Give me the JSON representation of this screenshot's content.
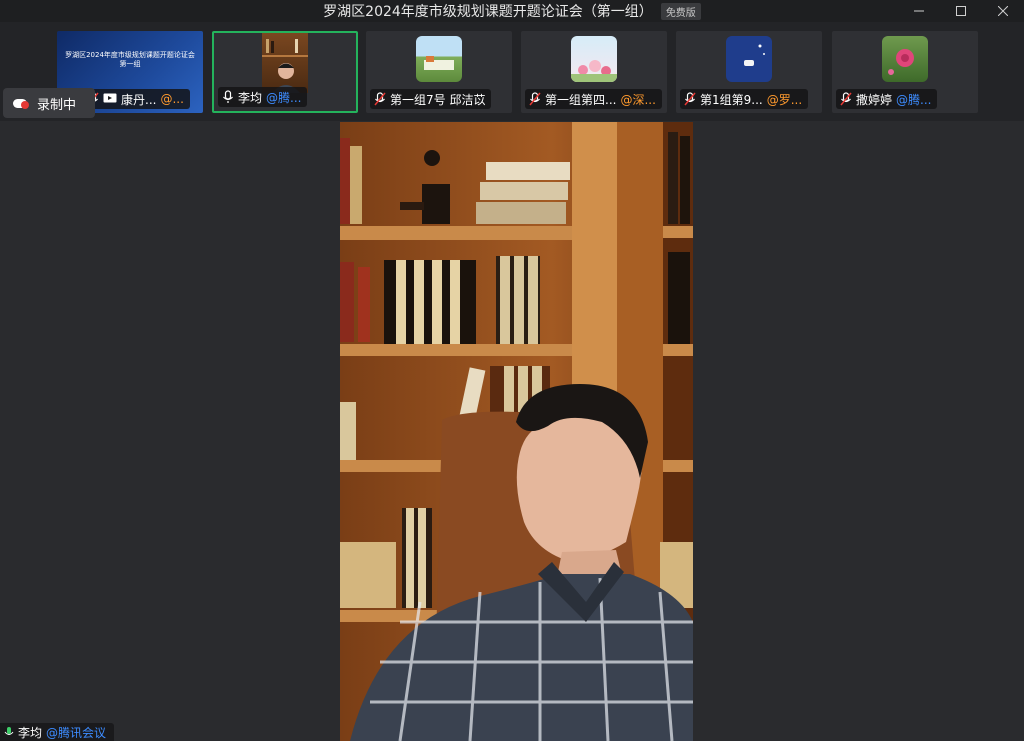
{
  "window": {
    "title": "罗湖区2024年度市级规划课题开题论证会（第一组）",
    "badge": "免费版"
  },
  "recording": {
    "label": "录制中"
  },
  "slide": {
    "text": "罗湖区2024年度市级规划课题开题论证会第一组"
  },
  "participants": [
    {
      "name": "康丹...",
      "source": "@...",
      "source_color": "orange",
      "muted": true,
      "sharing": true
    },
    {
      "name": "李均",
      "source": "@腾...",
      "source_color": "blue",
      "muted": false,
      "active": true
    },
    {
      "name": "第一组7号 邱洁苡",
      "source": "",
      "muted": true
    },
    {
      "name": "第一组第四...",
      "source": "@深...",
      "source_color": "orange",
      "muted": true
    },
    {
      "name": "第1组第9...",
      "source": "@罗...",
      "source_color": "orange",
      "muted": true
    },
    {
      "name": "撒婷婷",
      "source": "@腾...",
      "source_color": "blue",
      "muted": true
    }
  ],
  "speaker": {
    "name": "李均",
    "source": "@腾讯会议"
  },
  "colors": {
    "active_border": "#24b35c",
    "external_source": "#ff9a2e",
    "tencent_source": "#3d8cff",
    "share_badge": "#ef8a2b"
  }
}
